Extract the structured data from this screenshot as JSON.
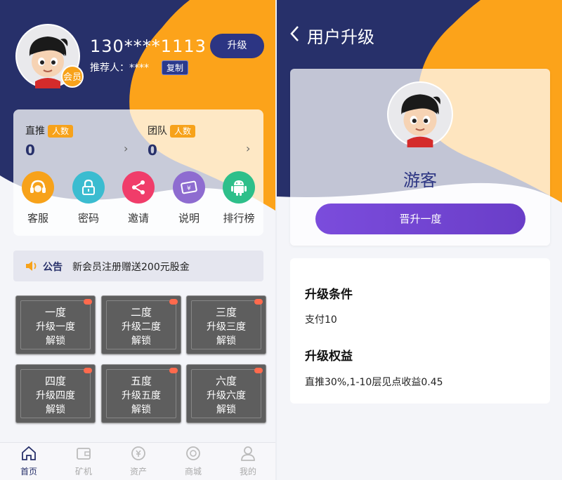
{
  "colors": {
    "navy": "#27306a",
    "orange": "#fca31a",
    "purple": "#7b4cdc",
    "badge_orange": "#f7a21a"
  },
  "home": {
    "phone": "130****1113",
    "referrer": "推荐人：****",
    "copy_label": "复制",
    "member_badge": "会员",
    "upgrade_label": "升级",
    "stats": [
      {
        "label": "直推",
        "tag": "人数",
        "value": "0"
      },
      {
        "label": "团队",
        "tag": "人数",
        "value": "0"
      }
    ],
    "shortcuts": [
      {
        "label": "客服",
        "icon": "headset-icon",
        "color": "#f7a21a"
      },
      {
        "label": "密码",
        "icon": "lock-icon",
        "color": "#3bbcd0"
      },
      {
        "label": "邀请",
        "icon": "share-icon",
        "color": "#f03d6a"
      },
      {
        "label": "说明",
        "icon": "ticket-icon",
        "color": "#8e6cd0"
      },
      {
        "label": "排行榜",
        "icon": "android-icon",
        "color": "#2ebf8a"
      }
    ],
    "notice": {
      "title": "公告",
      "text": "新会员注册赠送200元股金"
    },
    "levels": [
      {
        "name": "一度",
        "sub": "升级一度",
        "status": "解锁"
      },
      {
        "name": "二度",
        "sub": "升级二度",
        "status": "解锁"
      },
      {
        "name": "三度",
        "sub": "升级三度",
        "status": "解锁"
      },
      {
        "name": "四度",
        "sub": "升级四度",
        "status": "解锁"
      },
      {
        "name": "五度",
        "sub": "升级五度",
        "status": "解锁"
      },
      {
        "name": "六度",
        "sub": "升级六度",
        "status": "解锁"
      }
    ],
    "tabs": [
      {
        "label": "首页",
        "icon": "home-icon",
        "active": true
      },
      {
        "label": "矿机",
        "icon": "wallet-icon",
        "active": false
      },
      {
        "label": "资产",
        "icon": "asset-icon",
        "active": false
      },
      {
        "label": "商城",
        "icon": "store-icon",
        "active": false
      },
      {
        "label": "我的",
        "icon": "user-icon",
        "active": false
      }
    ]
  },
  "upgrade_page": {
    "title": "用户升级",
    "level_name": "游客",
    "button_label": "晋升一度",
    "conditions_title": "升级条件",
    "conditions_text": "支付10",
    "benefits_title": "升级权益",
    "benefits_text": "直推30%,1-10层见点收益0.45"
  }
}
